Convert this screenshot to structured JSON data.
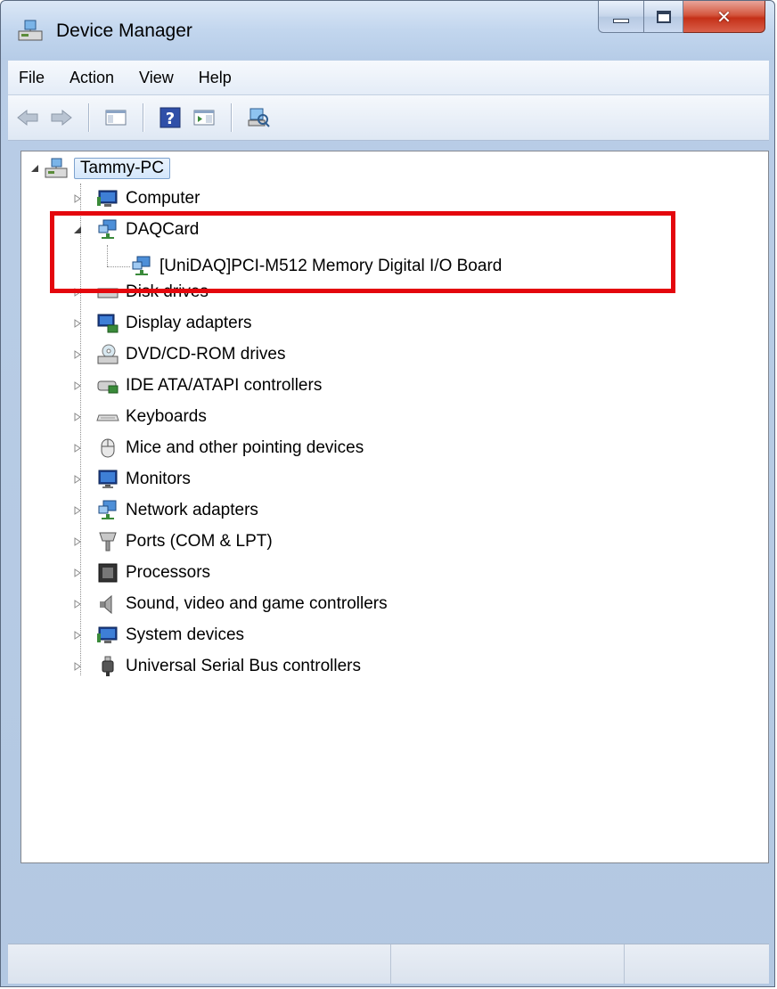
{
  "window": {
    "title": "Device Manager"
  },
  "menu": {
    "items": [
      "File",
      "Action",
      "View",
      "Help"
    ]
  },
  "toolbar": {
    "buttons": [
      "back-icon",
      "forward-icon",
      "show-hide-console-tree-icon",
      "help-icon",
      "show-hide-action-pane-icon",
      "scan-hardware-changes-icon"
    ]
  },
  "tree": {
    "root": "Tammy-PC",
    "items": [
      {
        "label": "Computer",
        "expanded": false
      },
      {
        "label": "DAQCard",
        "expanded": true,
        "children": [
          "[UniDAQ]PCI-M512 Memory Digital I/O Board"
        ]
      },
      {
        "label": "Disk drives",
        "expanded": false
      },
      {
        "label": "Display adapters",
        "expanded": false
      },
      {
        "label": "DVD/CD-ROM drives",
        "expanded": false
      },
      {
        "label": "IDE ATA/ATAPI controllers",
        "expanded": false
      },
      {
        "label": "Keyboards",
        "expanded": false
      },
      {
        "label": "Mice and other pointing devices",
        "expanded": false
      },
      {
        "label": "Monitors",
        "expanded": false
      },
      {
        "label": "Network adapters",
        "expanded": false
      },
      {
        "label": "Ports (COM & LPT)",
        "expanded": false
      },
      {
        "label": "Processors",
        "expanded": false
      },
      {
        "label": "Sound, video and game controllers",
        "expanded": false
      },
      {
        "label": "System devices",
        "expanded": false
      },
      {
        "label": "Universal Serial Bus controllers",
        "expanded": false
      }
    ]
  },
  "colors": {
    "highlight_box": "#e4070d",
    "close_button": "#c53018",
    "selection_border": "#7da2ce"
  }
}
